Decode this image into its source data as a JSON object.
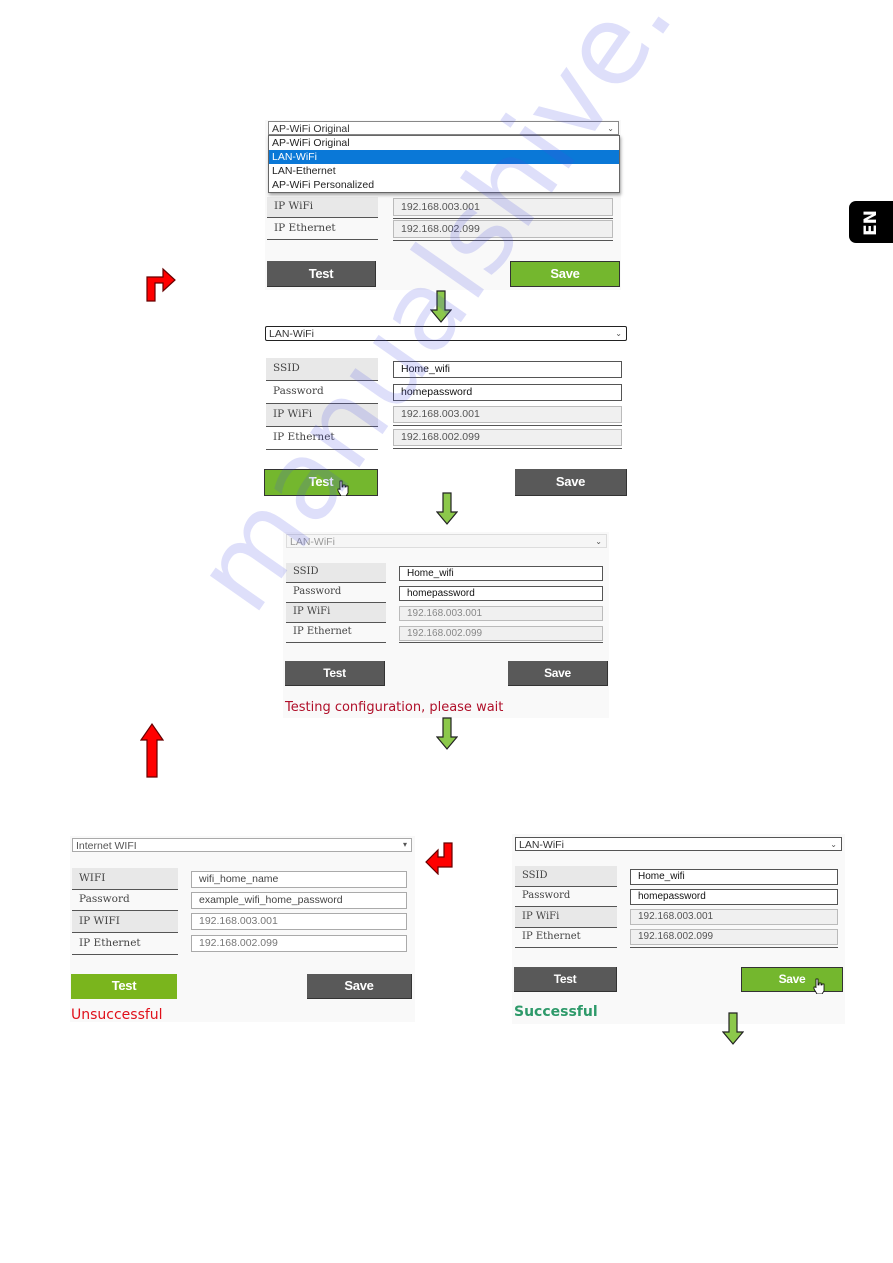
{
  "language_tab": "EN",
  "watermark": "manualshive.com",
  "step1": {
    "mode_select": "AP-WiFi Original",
    "dropdown_options": [
      "AP-WiFi Original",
      "LAN-WiFi",
      "LAN-Ethernet",
      "AP-WiFi Personalized"
    ],
    "highlighted_option": "LAN-WiFi",
    "fields": [
      {
        "label": "IP WiFi",
        "value": "192.168.003.001"
      },
      {
        "label": "IP Ethernet",
        "value": "192.168.002.099"
      }
    ],
    "test_label": "Test",
    "save_label": "Save"
  },
  "step2": {
    "mode_select": "LAN-WiFi",
    "fields": [
      {
        "label": "SSID",
        "value": "Home_wifi"
      },
      {
        "label": "Password",
        "value": "homepassword"
      },
      {
        "label": "IP WiFi",
        "value": "192.168.003.001"
      },
      {
        "label": "IP Ethernet",
        "value": "192.168.002.099"
      }
    ],
    "test_label": "Test",
    "save_label": "Save"
  },
  "step3": {
    "mode_select": "LAN-WiFi",
    "fields": [
      {
        "label": "SSID",
        "value": "Home_wifi"
      },
      {
        "label": "Password",
        "value": "homepassword"
      },
      {
        "label": "IP WiFi",
        "value": "192.168.003.001"
      },
      {
        "label": "IP Ethernet",
        "value": "192.168.002.099"
      }
    ],
    "test_label": "Test",
    "save_label": "Save",
    "status": "Testing configuration, please wait"
  },
  "fail": {
    "mode_select": "Internet WIFI",
    "fields": [
      {
        "label": "WIFI",
        "value": "wifi_home_name"
      },
      {
        "label": "Password",
        "value": "example_wifi_home_password"
      },
      {
        "label": "IP WIFI",
        "value": "192.168.003.001"
      },
      {
        "label": "IP Ethernet",
        "value": "192.168.002.099"
      }
    ],
    "test_label": "Test",
    "save_label": "Save",
    "status": "Unsuccessful"
  },
  "success": {
    "mode_select": "LAN-WiFi",
    "fields": [
      {
        "label": "SSID",
        "value": "Home_wifi"
      },
      {
        "label": "Password",
        "value": "homepassword"
      },
      {
        "label": "IP WiFi",
        "value": "192.168.003.001"
      },
      {
        "label": "IP Ethernet",
        "value": "192.168.002.099"
      }
    ],
    "test_label": "Test",
    "save_label": "Save",
    "status": "Successful"
  },
  "colors": {
    "green_button": "#74b72e",
    "gray_button": "#595959",
    "highlight": "#0a78d7",
    "testing_text": "#b0102a",
    "fail_text": "#e0101a",
    "success_text": "#2e9a6a",
    "arrow_red": "#ff0000",
    "arrow_green": "#8cc84b"
  }
}
